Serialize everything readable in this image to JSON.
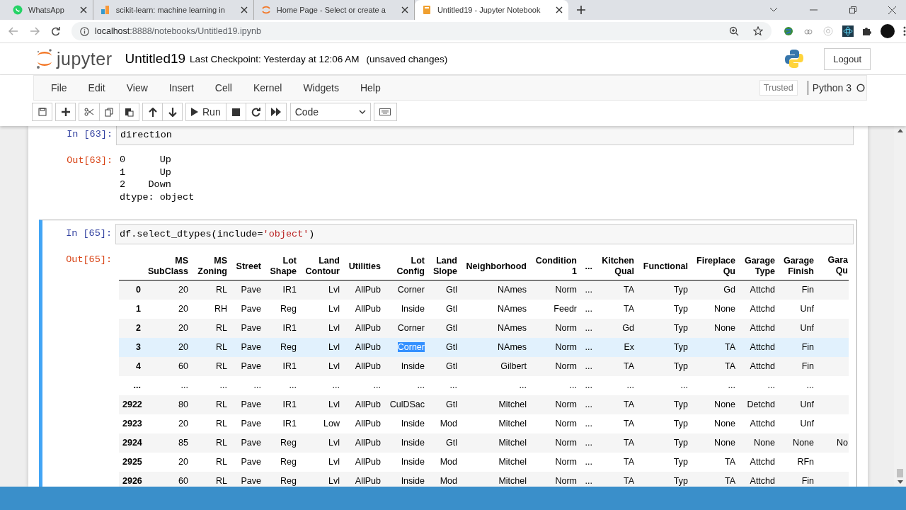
{
  "browser": {
    "tabs": [
      {
        "title": "WhatsApp",
        "selected": false
      },
      {
        "title": "scikit-learn: machine learning in",
        "selected": false
      },
      {
        "title": "Home Page - Select or create a",
        "selected": false
      },
      {
        "title": "Untitled19 - Jupyter Notebook",
        "selected": true
      }
    ],
    "url_host": "localhost",
    "url_rest": ":8888/notebooks/Untitled19.ipynb"
  },
  "header": {
    "logo_text": "jupyter",
    "title": "Untitled19",
    "checkpoint": "Last Checkpoint: Yesterday at 12:06 AM",
    "status": "(unsaved changes)",
    "logout": "Logout"
  },
  "menu": [
    "File",
    "Edit",
    "View",
    "Insert",
    "Cell",
    "Kernel",
    "Widgets",
    "Help"
  ],
  "trusted": "Trusted",
  "kernel": "Python 3",
  "toolbar": {
    "run": "Run",
    "cell_type": "Code"
  },
  "cells": [
    {
      "selected": false,
      "in_prompt": "In [63]:",
      "code": [
        {
          "text": "direction",
          "kind": "plain"
        }
      ],
      "out_prompt": "Out[63]:",
      "output": [
        "0      Up",
        "1      Up",
        "2    Down",
        "dtype: object"
      ]
    },
    {
      "selected": true,
      "in_prompt": "In [65]:",
      "code": [
        {
          "text": "df.select_dtypes(include=",
          "kind": "plain"
        },
        {
          "text": "'object'",
          "kind": "string"
        },
        {
          "text": ")",
          "kind": "plain"
        }
      ],
      "out_prompt": "Out[65]:",
      "table": {
        "columns": [
          "",
          "MS SubClass",
          "MS Zoning",
          "Street",
          "Lot Shape",
          "Land Contour",
          "Utilities",
          "Lot Config",
          "Land Slope",
          "Neighborhood",
          "Condition 1",
          "...",
          "Kitchen Qual",
          "Functional",
          "Fireplace Qu",
          "Garage Type",
          "Garage Finish",
          "Gara Qu"
        ],
        "rows": [
          {
            "selected": false,
            "cells": [
              "0",
              "20",
              "RL",
              "Pave",
              "IR1",
              "Lvl",
              "AllPub",
              "Corner",
              "Gtl",
              "NAmes",
              "Norm",
              "...",
              "TA",
              "Typ",
              "Gd",
              "Attchd",
              "Fin"
            ]
          },
          {
            "selected": false,
            "cells": [
              "1",
              "20",
              "RH",
              "Pave",
              "Reg",
              "Lvl",
              "AllPub",
              "Inside",
              "Gtl",
              "NAmes",
              "Feedr",
              "...",
              "TA",
              "Typ",
              "None",
              "Attchd",
              "Unf"
            ]
          },
          {
            "selected": false,
            "cells": [
              "2",
              "20",
              "RL",
              "Pave",
              "IR1",
              "Lvl",
              "AllPub",
              "Corner",
              "Gtl",
              "NAmes",
              "Norm",
              "...",
              "Gd",
              "Typ",
              "None",
              "Attchd",
              "Unf"
            ]
          },
          {
            "selected": true,
            "cells": [
              "3",
              "20",
              "RL",
              "Pave",
              "Reg",
              "Lvl",
              "AllPub",
              {
                "text": "Corner",
                "text_selected": true
              },
              "Gtl",
              "NAmes",
              "Norm",
              "...",
              "Ex",
              "Typ",
              "TA",
              "Attchd",
              "Fin"
            ]
          },
          {
            "selected": false,
            "cells": [
              "4",
              "60",
              "RL",
              "Pave",
              "IR1",
              "Lvl",
              "AllPub",
              "Inside",
              "Gtl",
              "Gilbert",
              "Norm",
              "...",
              "TA",
              "Typ",
              "TA",
              "Attchd",
              "Fin"
            ]
          },
          {
            "selected": false,
            "cells": [
              "...",
              "...",
              "...",
              "...",
              "...",
              "...",
              "...",
              "...",
              "...",
              "...",
              "...",
              "...",
              "...",
              "...",
              "...",
              "...",
              "..."
            ]
          },
          {
            "selected": false,
            "cells": [
              "2922",
              "80",
              "RL",
              "Pave",
              "IR1",
              "Lvl",
              "AllPub",
              "CulDSac",
              "Gtl",
              "Mitchel",
              "Norm",
              "...",
              "TA",
              "Typ",
              "None",
              "Detchd",
              "Unf"
            ]
          },
          {
            "selected": false,
            "cells": [
              "2923",
              "20",
              "RL",
              "Pave",
              "IR1",
              "Low",
              "AllPub",
              "Inside",
              "Mod",
              "Mitchel",
              "Norm",
              "...",
              "TA",
              "Typ",
              "None",
              "Attchd",
              "Unf"
            ]
          },
          {
            "selected": false,
            "cells": [
              "2924",
              "85",
              "RL",
              "Pave",
              "Reg",
              "Lvl",
              "AllPub",
              "Inside",
              "Gtl",
              "Mitchel",
              "Norm",
              "...",
              "TA",
              "Typ",
              "None",
              "None",
              "None",
              "No"
            ]
          },
          {
            "selected": false,
            "cells": [
              "2925",
              "20",
              "RL",
              "Pave",
              "Reg",
              "Lvl",
              "AllPub",
              "Inside",
              "Mod",
              "Mitchel",
              "Norm",
              "...",
              "TA",
              "Typ",
              "TA",
              "Attchd",
              "RFn"
            ]
          },
          {
            "selected": false,
            "cells": [
              "2926",
              "60",
              "RL",
              "Pave",
              "Reg",
              "Lvl",
              "AllPub",
              "Inside",
              "Mod",
              "Mitchel",
              "Norm",
              "...",
              "TA",
              "Typ",
              "TA",
              "Attchd",
              "Fin"
            ]
          }
        ]
      }
    }
  ]
}
